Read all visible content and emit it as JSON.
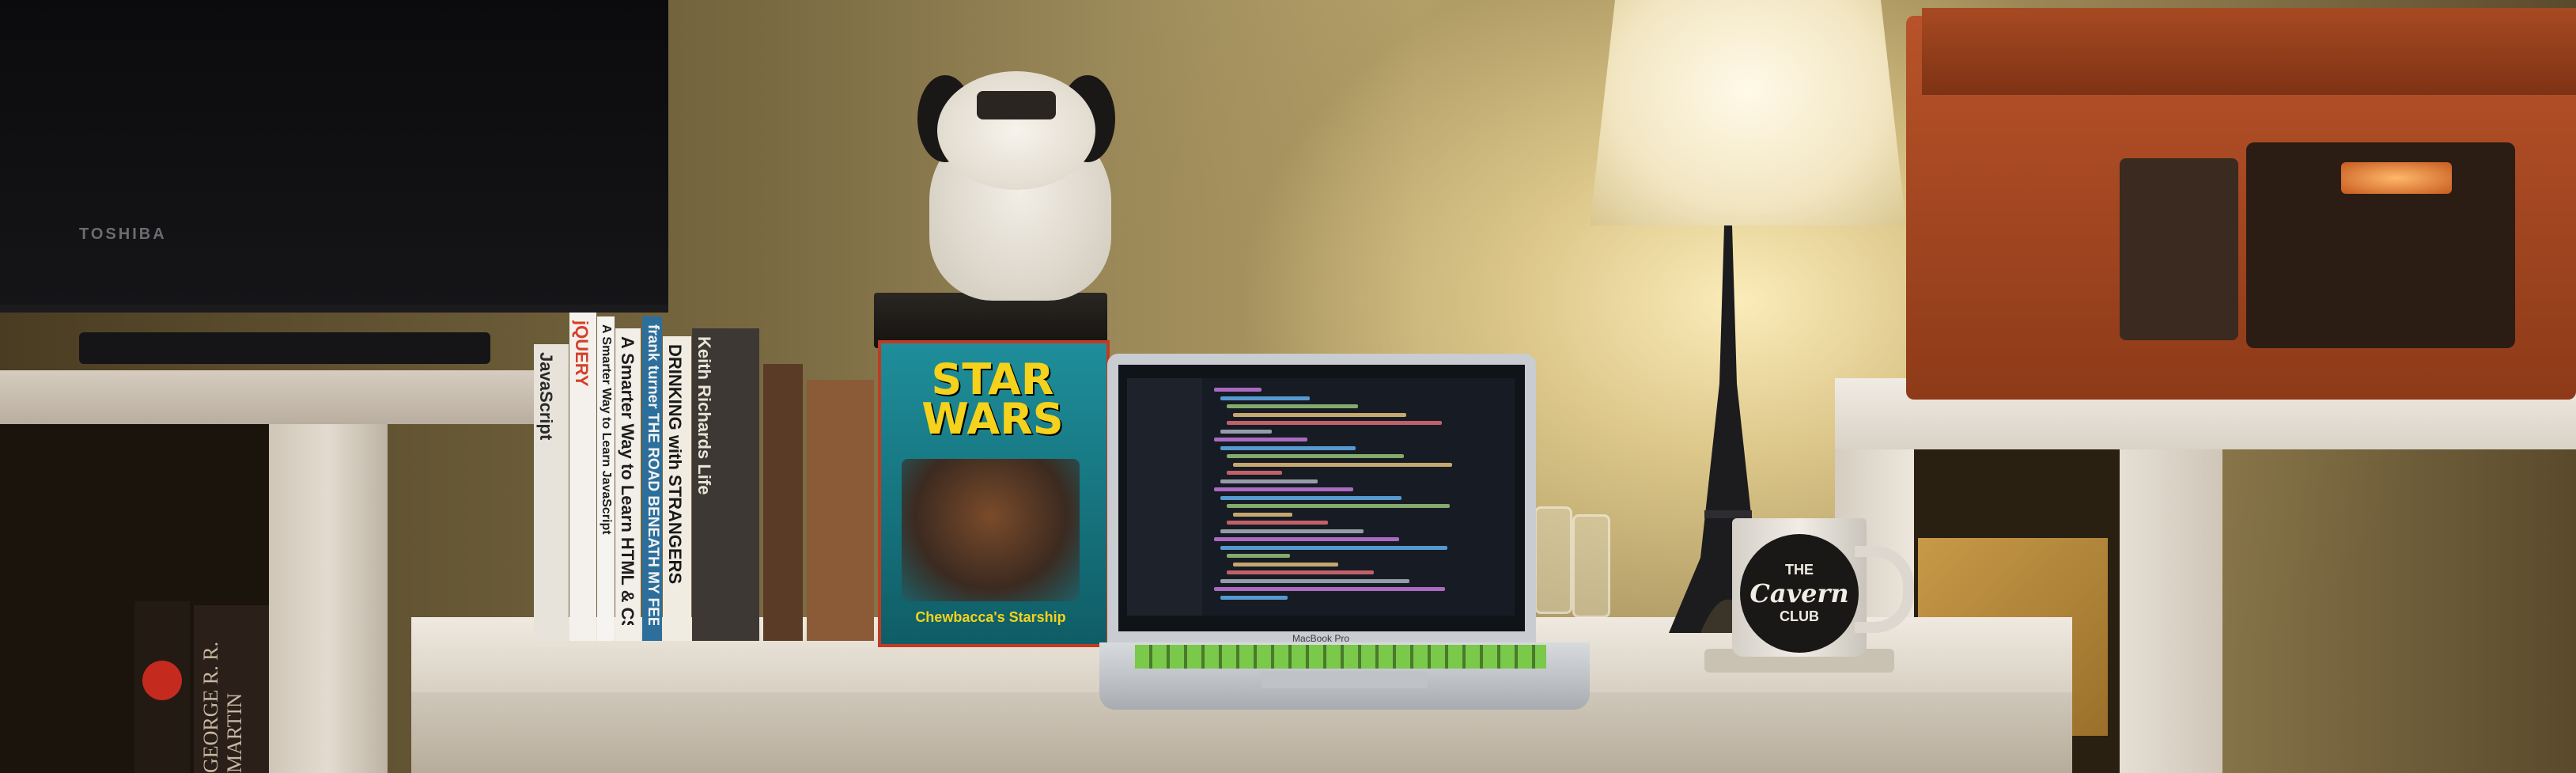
{
  "scene": {
    "tv_brand": "TOSHIBA",
    "comic_logo": "STAR WARS",
    "comic_footer": "Chewbacca's Starship",
    "laptop_brand": "MacBook Pro",
    "mug": {
      "line1": "THE",
      "line2": "Cavern",
      "line3": "CLUB"
    },
    "bottom_left_book": "GEORGE R. R. MARTIN"
  },
  "books": [
    {
      "title": "JavaScript",
      "color": "#e7e2da",
      "text_color": "#2a2a2a"
    },
    {
      "title": "jQUERY",
      "color": "#f4f1ec",
      "text_color": "#d4402a"
    },
    {
      "title": "A Smarter Way to Learn JavaScript",
      "color": "#f6f4f0",
      "text_color": "#1d1d1d"
    },
    {
      "title": "A Smarter Way to Learn HTML & CSS",
      "color": "#f2efe9",
      "text_color": "#1d1d1d"
    },
    {
      "title": "frank turner THE ROAD BENEATH MY FEET",
      "color": "#2c6f9c",
      "text_color": "#f2f2f2"
    },
    {
      "title": "DRINKING with STRANGERS",
      "color": "#f1ece2",
      "text_color": "#1a1a1a"
    },
    {
      "title": "Keith Richards Life",
      "color": "#3d3833",
      "text_color": "#e8e3d8"
    },
    {
      "title": "",
      "color": "#5a3b26",
      "text_color": "#e8e3d8"
    },
    {
      "title": "",
      "color": "#8a5b36",
      "text_color": "#e8e3d8"
    }
  ],
  "colors": {
    "wall_glow": "#f2e6c2",
    "desk": "#efe9e0",
    "record_player": "#b8532a",
    "comic_bg": "#1e8e9a",
    "keyboard_backlight": "#7ac94a"
  }
}
